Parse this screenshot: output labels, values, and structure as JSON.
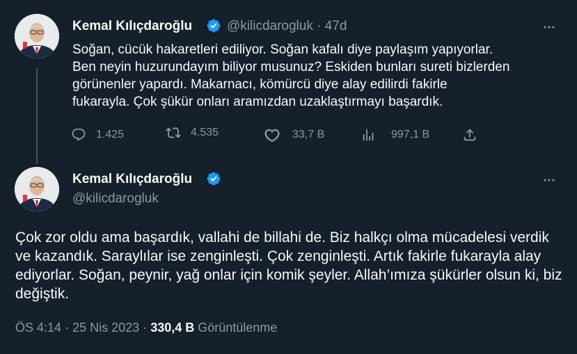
{
  "reply_tweet": {
    "author_name": "Kemal Kılıçdaroğlu",
    "handle": "@kilicdarogluk",
    "separator": "·",
    "time": "47d",
    "text": "Soğan, cücük hakaretleri ediliyor. Soğan kafalı diye paylaşım yapıyorlar.\nBen neyin huzurundayım biliyor musunuz? Eskiden bunları sureti bizlerden\ngörünenler yapardı. Makarnacı, kömürcü diye alay edilirdi fakirle\nfukarayla. Çok şükür onları aramızdan uzaklaştırmayı başardık.",
    "actions": {
      "reply_count": "1.425",
      "retweet_count": "4.535",
      "like_count": "33,7 B",
      "views_count": "997,1 B"
    }
  },
  "main_tweet": {
    "author_name": "Kemal Kılıçdaroğlu",
    "handle": "@kilicdarogluk",
    "text": "Çok zor oldu ama başardık, vallahi de billahi de. Biz halkçı olma mücadelesi verdik ve kazandık. Saraylılar ise zenginleşti. Çok zenginleşti. Artık fakirle fukarayla alay ediyorlar. Soğan, peynir, yağ onlar için komik şeyler. Allah’ımıza şükürler olsun ki, biz değiştik.",
    "time": "ÖS 4:14",
    "dot": "·",
    "date": "25 Nis 2023",
    "views_count": "330,4 B",
    "views_label": "Görüntülenme"
  },
  "colors": {
    "background": "#15202b",
    "text": "#f7f9f9",
    "muted": "#8b98a5",
    "verified": "#1d9bf0",
    "thread_line": "#425364"
  }
}
